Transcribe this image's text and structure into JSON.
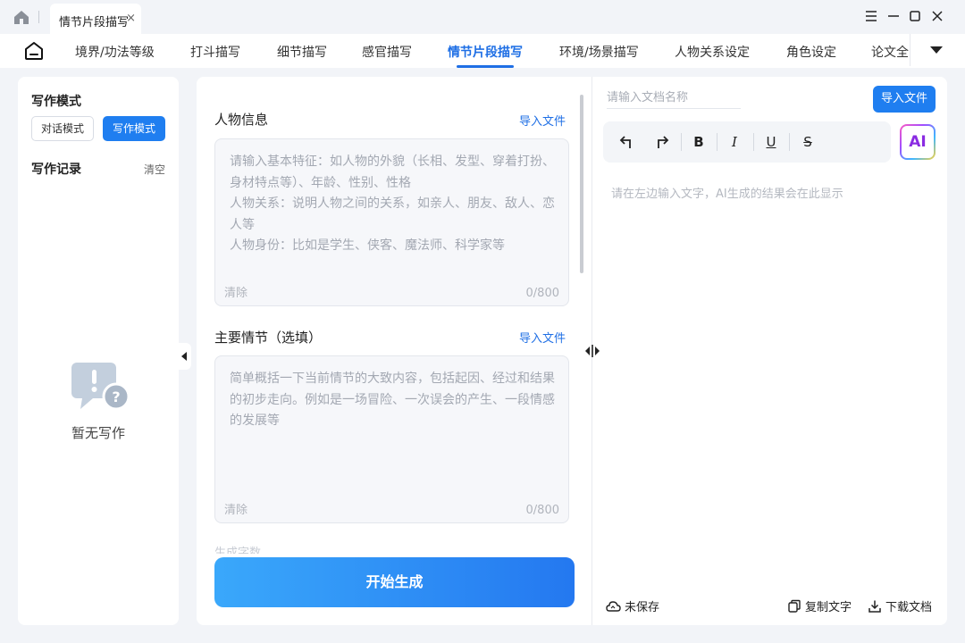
{
  "titlebar": {
    "tab_title": "情节片段描写",
    "close_symbol": "×"
  },
  "nav": {
    "items": [
      "境界/功法等级",
      "打斗描写",
      "细节描写",
      "感官描写",
      "情节片段描写",
      "环境/场景描写",
      "人物关系设定",
      "角色设定",
      "论文全"
    ],
    "active_index": 4
  },
  "sidebar": {
    "mode_title": "写作模式",
    "dialog_mode": "对话模式",
    "writing_mode": "写作模式",
    "record_title": "写作记录",
    "clear_label": "清空",
    "empty_text": "暂无写作"
  },
  "form": {
    "character": {
      "title": "人物信息",
      "import_label": "导入文件",
      "placeholder": "请输入基本特征：如人物的外貌（长相、发型、穿着打扮、身材特点等）、年龄、性别、性格\n人物关系：说明人物之间的关系，如亲人、朋友、敌人、恋人等\n人物身份：比如是学生、侠客、魔法师、科学家等",
      "clear_label": "清除",
      "counter": "0/800"
    },
    "plot": {
      "title": "主要情节（选填）",
      "import_label": "导入文件",
      "placeholder": "简单概括一下当前情节的大致内容，包括起因、经过和结果的初步走向。例如是一场冒险、一次误会的产生、一段情感的发展等",
      "clear_label": "清除",
      "counter": "0/800"
    },
    "word_count_label": "生成字数",
    "generate_label": "开始生成"
  },
  "editor": {
    "doc_name_placeholder": "请输入文档名称",
    "import_label": "导入文件",
    "toolbar": [
      "undo-icon",
      "redo-icon",
      "bold-icon",
      "italic-icon",
      "underline-icon",
      "strikethrough-icon"
    ],
    "ai_label": "AI",
    "output_placeholder": "请在左边输入文字，AI生成的结果会在此显示",
    "save_status": "未保存",
    "copy_label": "复制文字",
    "download_label": "下载文档"
  },
  "colors": {
    "accent": "#1f7ef0",
    "link": "#1f6fe5",
    "background": "#f2f4f8"
  }
}
